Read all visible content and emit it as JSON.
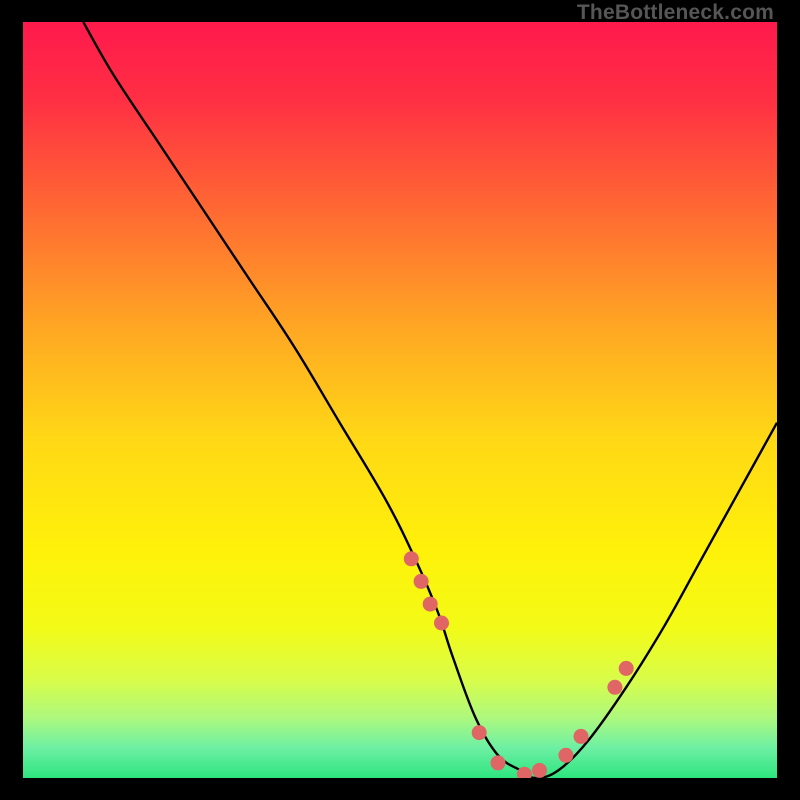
{
  "watermark": "TheBottleneck.com",
  "chart_data": {
    "type": "line",
    "title": "",
    "xlabel": "",
    "ylabel": "",
    "xlim": [
      0,
      100
    ],
    "ylim": [
      0,
      100
    ],
    "x": [
      8,
      12,
      18,
      24,
      30,
      36,
      42,
      48,
      52,
      55,
      57,
      60,
      63,
      66,
      68,
      71,
      75,
      80,
      85,
      90,
      95,
      100
    ],
    "values": [
      100,
      93,
      84,
      75,
      66,
      57,
      47,
      37,
      29,
      22,
      16,
      8,
      3,
      1,
      0,
      1,
      5,
      12,
      20,
      29,
      38,
      47
    ],
    "markers_x": [
      51.5,
      52.8,
      54,
      55.5,
      60.5,
      63,
      66.5,
      68.5,
      72,
      74,
      78.5,
      80
    ],
    "markers_y": [
      29,
      26,
      23,
      20.5,
      6,
      2,
      0.5,
      1,
      3,
      5.5,
      12,
      14.5
    ],
    "gradient_stops": [
      {
        "offset": 0.0,
        "color": "#ff1a4d"
      },
      {
        "offset": 0.1,
        "color": "#ff2f44"
      },
      {
        "offset": 0.25,
        "color": "#ff6a33"
      },
      {
        "offset": 0.4,
        "color": "#ffa624"
      },
      {
        "offset": 0.55,
        "color": "#ffd816"
      },
      {
        "offset": 0.7,
        "color": "#fff20a"
      },
      {
        "offset": 0.8,
        "color": "#f3fb17"
      },
      {
        "offset": 0.87,
        "color": "#d9fd4a"
      },
      {
        "offset": 0.92,
        "color": "#aef97e"
      },
      {
        "offset": 0.96,
        "color": "#6ef0a4"
      },
      {
        "offset": 1.0,
        "color": "#2ee57f"
      }
    ],
    "marker_color": "#e06666",
    "curve_color": "#000000"
  }
}
